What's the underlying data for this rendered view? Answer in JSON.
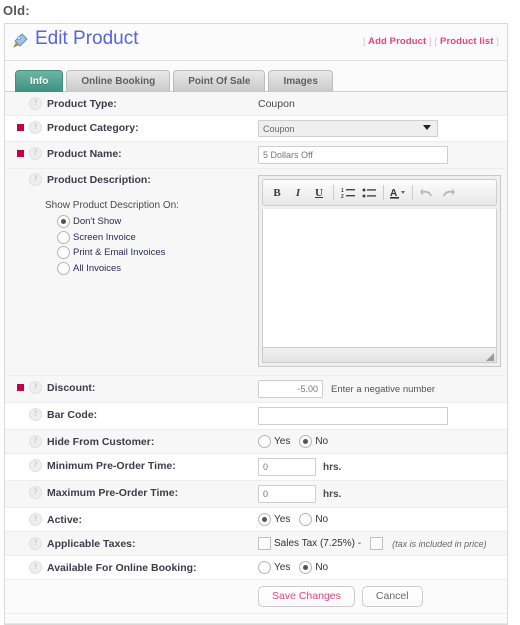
{
  "page": {
    "old_label": "Old:"
  },
  "header": {
    "title": "Edit Product",
    "title_icon": "tag-pencil-icon",
    "links": [
      {
        "label": "Add Product",
        "name": "add-product-link"
      },
      {
        "label": "Product list",
        "name": "product-list-link"
      }
    ],
    "bracket_open": "[",
    "bracket_close": "]"
  },
  "tabs": [
    {
      "label": "Info",
      "active": true
    },
    {
      "label": "Online Booking",
      "active": false
    },
    {
      "label": "Point Of Sale",
      "active": false
    },
    {
      "label": "Images",
      "active": false
    }
  ],
  "form": {
    "product_type": {
      "label": "Product Type:",
      "value": "Coupon"
    },
    "product_category": {
      "label": "Product Category:",
      "selected": "Coupon",
      "options": [
        "Coupon"
      ]
    },
    "product_name": {
      "label": "Product Name:",
      "value": "5 Dollars Off"
    },
    "product_description": {
      "label": "Product Description:",
      "show_on_label": "Show Product Description On:",
      "show_on_options": [
        {
          "label": "Don't Show",
          "selected": true
        },
        {
          "label": "Screen Invoice",
          "selected": false
        },
        {
          "label": "Print & Email Invoices",
          "selected": false
        },
        {
          "label": "All Invoices",
          "selected": false
        }
      ],
      "editor_body": "",
      "toolbar": [
        {
          "glyph": "B",
          "name": "bold-icon",
          "style": "bold"
        },
        {
          "glyph": "I",
          "name": "italic-icon",
          "style": "italic"
        },
        {
          "glyph": "U",
          "name": "underline-icon",
          "style": "underline"
        },
        {
          "glyph": "sep",
          "name": "toolbar-separator",
          "style": "sep"
        },
        {
          "glyph": "ordered",
          "name": "ordered-list-icon",
          "style": "icon"
        },
        {
          "glyph": "unordered",
          "name": "unordered-list-icon",
          "style": "icon"
        },
        {
          "glyph": "sep",
          "name": "toolbar-separator",
          "style": "sep"
        },
        {
          "glyph": "A",
          "name": "text-color-icon",
          "style": "color"
        },
        {
          "glyph": "sep",
          "name": "toolbar-separator",
          "style": "sep"
        },
        {
          "glyph": "undo",
          "name": "undo-icon",
          "style": "icon"
        },
        {
          "glyph": "redo",
          "name": "redo-icon",
          "style": "icon"
        }
      ]
    },
    "discount": {
      "label": "Discount:",
      "value": "-5.00",
      "hint": "Enter a negative number"
    },
    "bar_code": {
      "label": "Bar Code:",
      "value": ""
    },
    "hide_from_customer": {
      "label": "Hide From Customer:",
      "yes_label": "Yes",
      "no_label": "No",
      "selected": "No"
    },
    "minimum_pre_order": {
      "label": "Minimum Pre-Order Time:",
      "value": "0",
      "unit": "hrs."
    },
    "maximum_pre_order": {
      "label": "Maximum Pre-Order Time:",
      "value": "0",
      "unit": "hrs."
    },
    "active": {
      "label": "Active:",
      "yes_label": "Yes",
      "no_label": "No",
      "selected": "Yes"
    },
    "applicable_taxes": {
      "label": "Applicable Taxes:",
      "tax_label": "Sales Tax (7.25%) -",
      "tax_checked": false,
      "included_label": "(tax is included in price)",
      "included_checked": false
    },
    "available_online": {
      "label": "Available For Online Booking:",
      "yes_label": "Yes",
      "no_label": "No",
      "selected": "No"
    }
  },
  "footer": {
    "save_label": "Save Changes",
    "cancel_label": "Cancel"
  },
  "colors": {
    "accent_pink": "#ef3d7e",
    "required_red": "#c4004c",
    "tab_active": "#3d9181",
    "title_blue": "#5566dd"
  }
}
